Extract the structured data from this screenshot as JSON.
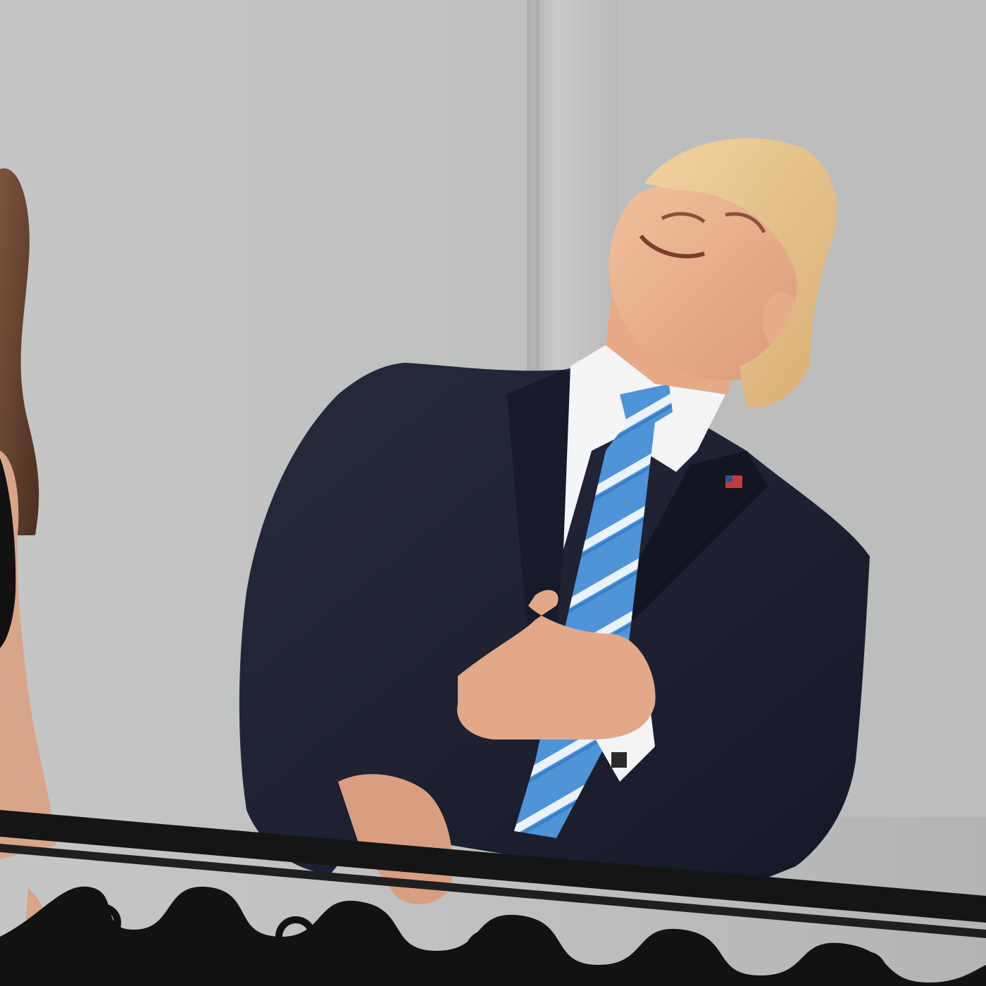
{
  "photo": {
    "kind": "photograph",
    "visible_text": []
  },
  "palette": {
    "wall_light": "#c7c9c8",
    "wall_mid": "#b6b8b7",
    "wall_shadow": "#a8aaaa",
    "suit": "#1c2030",
    "suit_shadow": "#10131d",
    "shirt": "#f4f5f7",
    "tie": "#4f93d8",
    "tie_stripe": "#e8f0fb",
    "skin": "#e9b08d",
    "hair": "#e7c48c",
    "railing": "#141414",
    "woman_hair": "#6a4632",
    "woman_dress": "#111111"
  }
}
